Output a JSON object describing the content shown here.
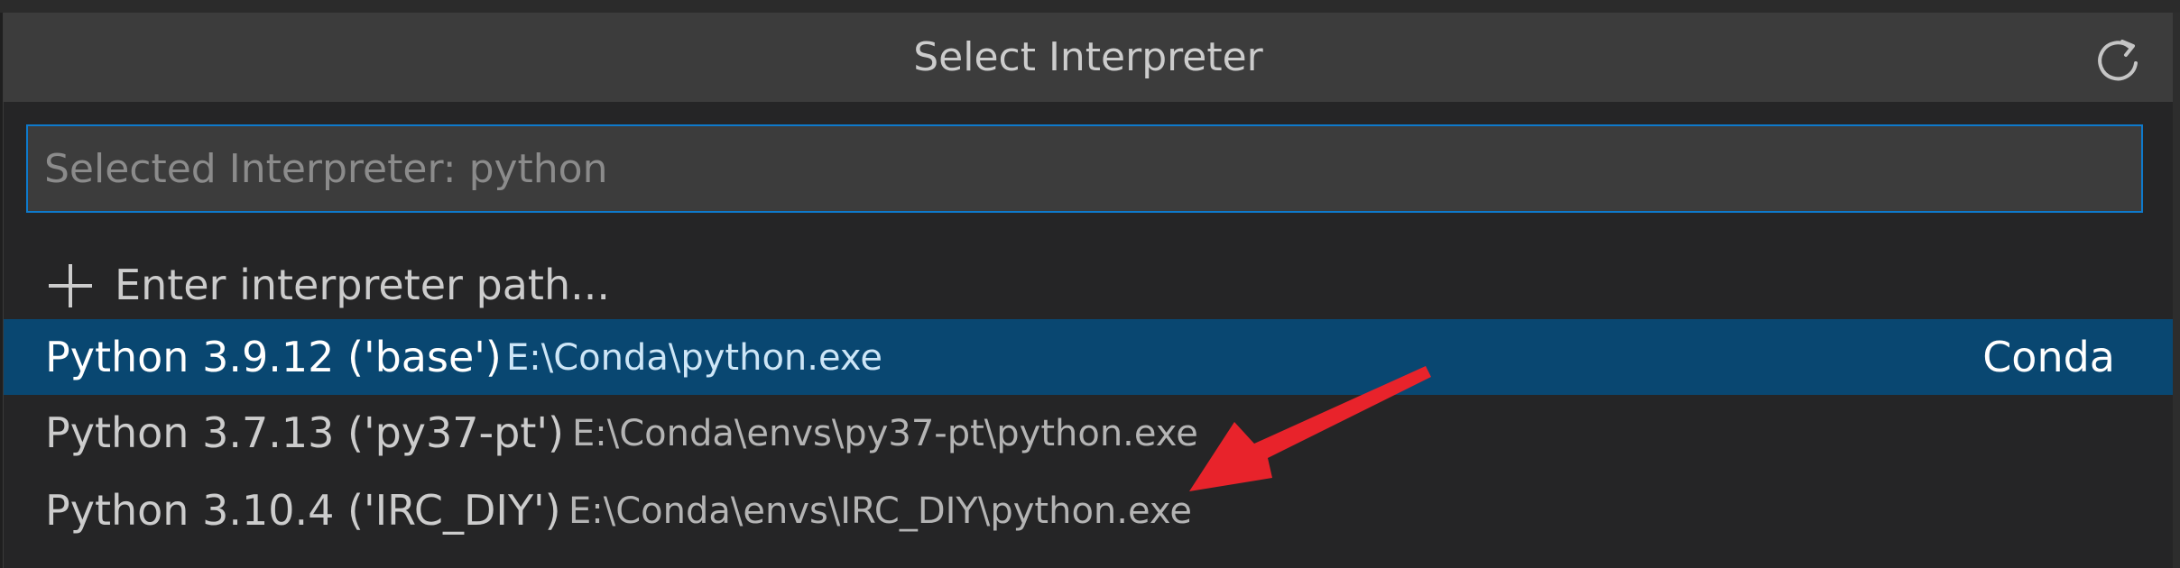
{
  "picker": {
    "title": "Select Interpreter",
    "refresh_icon": "refresh-icon",
    "search": {
      "value": "",
      "placeholder": "Selected Interpreter: python"
    },
    "enter_path": {
      "icon": "plus-icon",
      "label": "Enter interpreter path..."
    },
    "interpreters": [
      {
        "label": "Python 3.9.12 ('base')",
        "path": "E:\\Conda\\python.exe",
        "tag": "Conda",
        "selected": true
      },
      {
        "label": "Python 3.7.13 ('py37-pt')",
        "path": "E:\\Conda\\envs\\py37-pt\\python.exe",
        "tag": "",
        "selected": false
      },
      {
        "label": "Python 3.10.4 ('IRC_DIY')",
        "path": "E:\\Conda\\envs\\IRC_DIY\\python.exe",
        "tag": "",
        "selected": false
      }
    ]
  },
  "annotation": {
    "icon": "red-arrow-icon",
    "color": "#e8232b"
  },
  "colors": {
    "accent": "#0e7acc",
    "selection": "#094771"
  }
}
